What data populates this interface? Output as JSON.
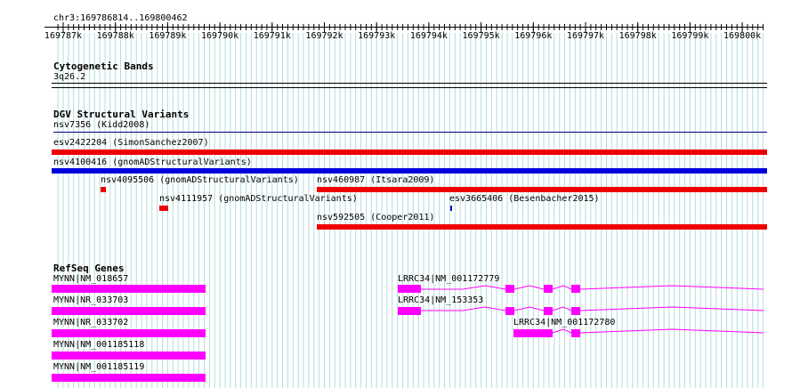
{
  "ruler": {
    "location": "chr3:169786814..169800462",
    "ticks": [
      "169787k",
      "169788k",
      "169789k",
      "169790k",
      "169791k",
      "169792k",
      "169793k",
      "169794k",
      "169795k",
      "169796k",
      "169797k",
      "169798k",
      "169799k",
      "169800k"
    ]
  },
  "tracks": {
    "cytobands": {
      "title": "Cytogenetic Bands",
      "band": "3q26.2"
    },
    "dgv": {
      "title": "DGV Structural Variants",
      "items": [
        {
          "label": "nsv7356 (Kidd2008)"
        },
        {
          "label": "esv2422204 (SimonSanchez2007)"
        },
        {
          "label": "nsv4100416 (gnomADStructuralVariants)"
        },
        {
          "label": "nsv4095506 (gnomADStructuralVariants)"
        },
        {
          "label": "nsv460987 (Itsara2009)"
        },
        {
          "label": "nsv4111957 (gnomADStructuralVariants)"
        },
        {
          "label": "esv3665406 (Besenbacher2015)"
        },
        {
          "label": "nsv592505 (Cooper2011)"
        }
      ]
    },
    "refseq": {
      "title": "RefSeq Genes",
      "items": [
        {
          "label": "MYNN|NM_018657"
        },
        {
          "label": "MYNN|NR_033703"
        },
        {
          "label": "MYNN|NR_033702"
        },
        {
          "label": "MYNN|NM_001185118"
        },
        {
          "label": "MYNN|NM_001185119"
        },
        {
          "label": "LRRC34|NM_001172779"
        },
        {
          "label": "LRRC34|NM_153353"
        },
        {
          "label": "LRRC34|NM_001172780"
        }
      ]
    }
  },
  "colors": {
    "loss": "#ee0000",
    "gain": "#0000dd",
    "gene": "#ff00ff",
    "grid": "#b4dcdc"
  }
}
